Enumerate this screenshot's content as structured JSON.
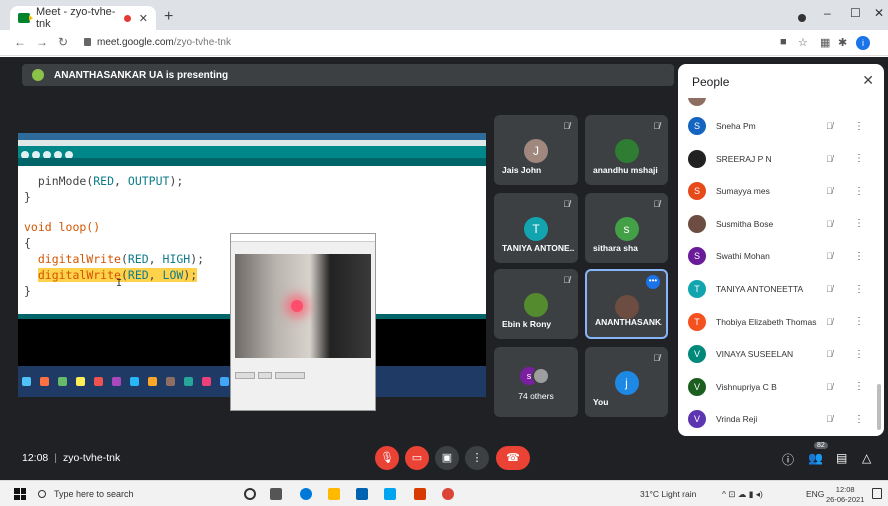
{
  "browser": {
    "tab_title": "Meet - zyo-tvhe-tnk",
    "url_host": "meet.google.com",
    "url_path": "/zyo-tvhe-tnk"
  },
  "meet": {
    "presenting_banner": "ANANTHASANKAR UA is presenting",
    "code_lines": [
      {
        "fn": "  pinMode",
        "args_open": "(",
        "c1": "RED",
        "mid": ", ",
        "c2": "OUTPUT",
        "end": ");"
      },
      {
        "plain": "}"
      },
      {
        "plain": ""
      },
      {
        "plain": "void loop()"
      },
      {
        "plain": "{"
      },
      {
        "fn": "  digitalWrite",
        "args_open": "(",
        "c1": "RED",
        "mid": ", ",
        "c2": "HIGH",
        "end": ");"
      },
      {
        "fn": "  digitalWrite",
        "args_open": "(",
        "c1": "RED",
        "mid": ", ",
        "c2": "LOW",
        "end": ");",
        "highlight": true
      },
      {
        "plain": "}"
      }
    ],
    "tiles": [
      {
        "name": "Jais John",
        "initial": "J",
        "color": "#a1887f"
      },
      {
        "name": "anandhu mshaji",
        "initial": "",
        "color": "#2e7d32"
      },
      {
        "name": "TANIYA ANTONE...",
        "initial": "T",
        "color": "#12a4af"
      },
      {
        "name": "sithara sha",
        "initial": "s",
        "color": "#43a047"
      },
      {
        "name": "Ebin k Rony",
        "initial": "",
        "color": "#558b2f"
      },
      {
        "name": "ANANTHASANK...",
        "initial": "",
        "color": "#6d4c41"
      },
      {
        "name": "74 others",
        "initial": "s"
      },
      {
        "name": "You",
        "initial": "j",
        "color": "#1e88e5"
      }
    ]
  },
  "people_panel": {
    "title": "People",
    "people": [
      {
        "name": "Sneha Pm",
        "initial": "S",
        "color": "#1565c0"
      },
      {
        "name": "SREERAJ P N",
        "initial": "",
        "color": "#212121"
      },
      {
        "name": "Sumayya mes",
        "initial": "S",
        "color": "#e64a19"
      },
      {
        "name": "Susmitha Bose",
        "initial": "",
        "color": "#6d4c41"
      },
      {
        "name": "Swathi Mohan",
        "initial": "S",
        "color": "#6a1b9a"
      },
      {
        "name": "TANIYA ANTONEETTA",
        "initial": "T",
        "color": "#12a4af"
      },
      {
        "name": "Thobiya Elizabeth Thomas",
        "initial": "T",
        "color": "#f4511e"
      },
      {
        "name": "VINAYA SUSEELAN",
        "initial": "V",
        "color": "#00897b"
      },
      {
        "name": "Vishnupriya C B",
        "initial": "V",
        "color": "#1b5e20"
      },
      {
        "name": "Vrinda Reji",
        "initial": "V",
        "color": "#5e35b1"
      }
    ]
  },
  "bottom_bar": {
    "time": "12:08",
    "meeting_code": "zyo-tvhe-tnk",
    "participant_count": "82"
  },
  "taskbar": {
    "search_placeholder": "Type here to search",
    "weather": "31°C  Light rain",
    "lang": "ENG",
    "clock_time": "12:08",
    "clock_date": "26-06-2021"
  }
}
